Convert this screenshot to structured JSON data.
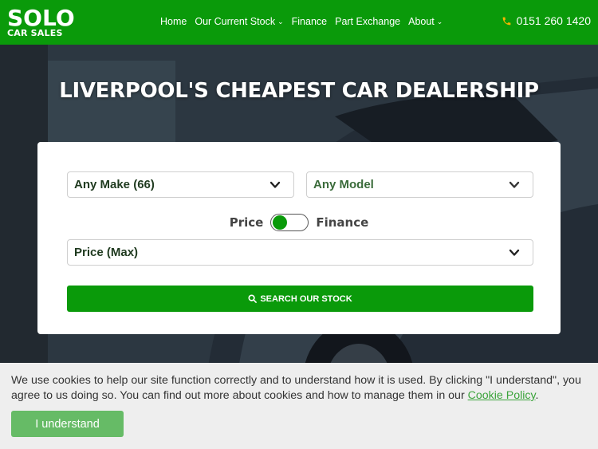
{
  "logo": {
    "line1": "SOLO",
    "line2": "CAR SALES"
  },
  "nav": {
    "items": [
      {
        "label": "Home",
        "caret": false
      },
      {
        "label": "Our Current Stock",
        "caret": true
      },
      {
        "label": "Finance",
        "caret": false
      },
      {
        "label": "Part Exchange",
        "caret": false
      },
      {
        "label": "About",
        "caret": true
      }
    ],
    "phone": "0151 260 1420"
  },
  "hero": {
    "title": "LIVERPOOL'S CHEAPEST CAR DEALERSHIP"
  },
  "search": {
    "make_select": "Any Make (66)",
    "model_select": "Any Model",
    "toggle_left": "Price",
    "toggle_right": "Finance",
    "price_select": "Price (Max)",
    "button_label": "SEARCH OUR STOCK"
  },
  "cookie": {
    "text": "We use cookies to help our site function correctly and to understand how it is used. By clicking \"I understand\", you agree to us doing so. You can find out more about cookies and how to manage them in our",
    "link": "Cookie Policy",
    "period": ".",
    "button": "I understand"
  },
  "colors": {
    "brand_green": "#0a9a0a",
    "cookie_button": "#66bb66",
    "phone_icon": "#f5b400"
  }
}
